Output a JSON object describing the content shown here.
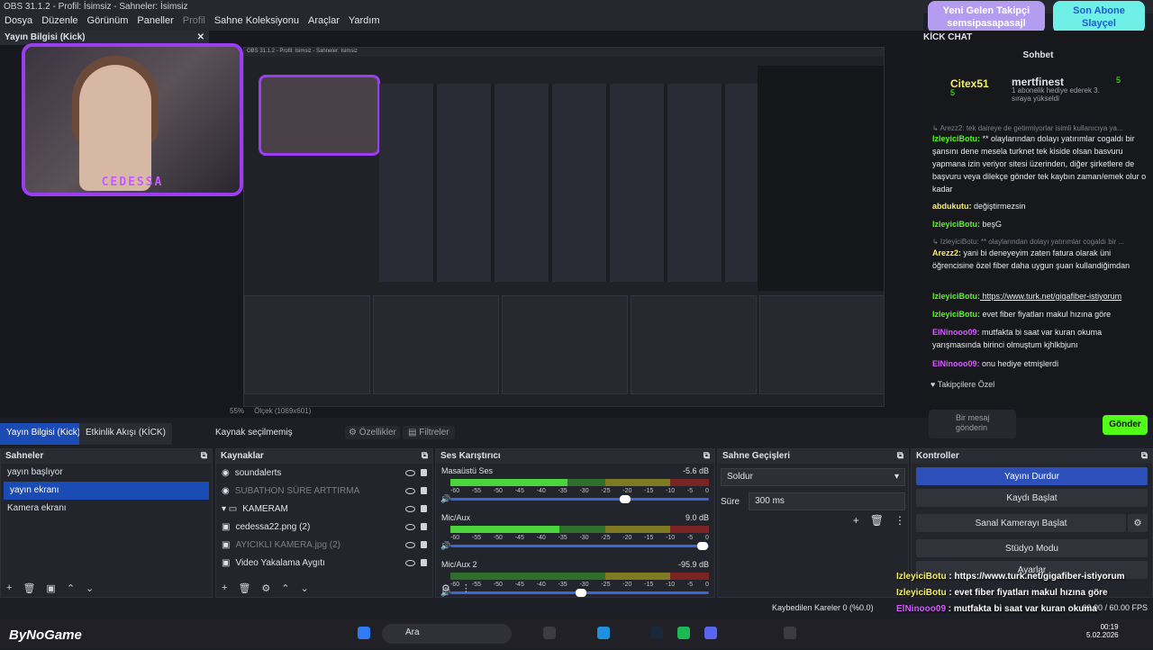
{
  "window": {
    "title": "OBS 31.1.2 - Profil: İsimsiz - Sahneler: İsimsiz"
  },
  "menu": {
    "items": [
      "Dosya",
      "Düzenle",
      "Görünüm",
      "Paneller",
      "Profil",
      "Sahne Koleksiyonu",
      "Araçlar",
      "Yardım"
    ]
  },
  "kick_dock": {
    "title": "Yayın Bilgisi (Kick)"
  },
  "webcam": {
    "label": "CEDESSA"
  },
  "preview": {
    "zoom": "55%",
    "scale_label": "Ölçek (1069x601)"
  },
  "tabs": {
    "kick": "Yayın Bilgisi (Kick)",
    "activity": "Etkinlik Akışı (KİCK)"
  },
  "source_toolbar": {
    "no_source": "Kaynak seçilmemiş",
    "properties": "Özellikler",
    "filters": "Filtreler"
  },
  "scenes": {
    "title": "Sahneler",
    "items": [
      "yayın başlıyor",
      "yayın ekranı",
      "Kamera ekranı"
    ],
    "selected_index": 1
  },
  "sources": {
    "title": "Kaynaklar",
    "items": [
      {
        "name": "soundalerts",
        "dim": false
      },
      {
        "name": "SUBATHON SÜRE ARTTIRMA",
        "dim": true
      },
      {
        "name": "KAMERAM",
        "dim": false
      },
      {
        "name": "cedessa22.png (2)",
        "dim": false
      },
      {
        "name": "AYICIKLI KAMERA.jpg (2)",
        "dim": true
      },
      {
        "name": "Video Yakalama Aygıtı",
        "dim": false
      }
    ]
  },
  "mixer": {
    "title": "Ses Karıştırıcı",
    "scale": [
      "-60",
      "-55",
      "-50",
      "-45",
      "-40",
      "-35",
      "-30",
      "-25",
      "-20",
      "-15",
      "-10",
      "-5",
      "0"
    ],
    "channels": [
      {
        "name": "Masaüstü Ses",
        "db": "-5.6 dB",
        "level": 0.45,
        "fader": 0.68
      },
      {
        "name": "Mic/Aux",
        "db": "9.0 dB",
        "level": 0.42,
        "fader": 0.99
      },
      {
        "name": "Mic/Aux 2",
        "db": "-95.9 dB",
        "level": 0.0,
        "fader": 0.5
      }
    ]
  },
  "transitions": {
    "title": "Sahne Geçişleri",
    "selected": "Soldur",
    "duration_label": "Süre",
    "duration_value": "300 ms"
  },
  "controls": {
    "title": "Kontroller",
    "buttons": [
      "Yayını Durdur",
      "Kaydı Başlat",
      "Sanal Kamerayı Başlat",
      "Stüdyo Modu",
      "Ayarlar"
    ]
  },
  "status": {
    "dropped": "Kaybedilen Kareler 0 (%0.0)",
    "fps": "60.00 / 60.00 FPS"
  },
  "chat": {
    "title": "KİCK CHAT",
    "heading": "Sohbet",
    "pinned_user": "Citex51",
    "pinned_count": "5",
    "pinned_gifter": "mertfinest",
    "pinned_gifter_count": "5",
    "pinned_text": "1 abonelik hediye ederek 3. sıraya yükseldi",
    "messages": [
      {
        "user": "",
        "text": "Arezz2: tek daireye de getirmiyorlar isimli kullanıcıya ya...",
        "cls": "reply"
      },
      {
        "user": "IzleyiciBotu:",
        "text": " ** olaylarından dolayı yatırımlar cogaldı bir şansını dene mesela turknet tek kiside olsan basvuru yapmana izin veriyor sitesi üzerinden, diğer şirketlere de başvuru veya dilekçe gönder tek kaybın zaman/emek olur o kadar",
        "cls": "user-g"
      },
      {
        "user": "abdukutu:",
        "text": " değiştirmezsin",
        "cls": "user-y"
      },
      {
        "user": "IzleyiciBotu:",
        "text": " beşG",
        "cls": "user-g"
      },
      {
        "user": "",
        "text": "IzleyiciBotu: ** olaylarından dolayı yatırımlar cogaldı bir ...",
        "cls": "reply"
      },
      {
        "user": "Arezz2:",
        "text": " yani bi deneyeyim zaten fatura olarak üni öğrencisine özel fiber daha uygun şuan kullandiğimdan",
        "cls": "user-y"
      },
      {
        "user": "IzleyiciBotu:",
        "text": " https://www.turk.net/gigafiber-istiyorum",
        "cls": "user-g",
        "link": true
      },
      {
        "user": "IzleyiciBotu:",
        "text": " evet fiber fiyatları makul hızına göre",
        "cls": "user-g"
      },
      {
        "user": "ElNinooo09:",
        "text": " mutfakta bi saat var kuran okuma yarışmasında birinci olmuştum kjhlkbjunı",
        "cls": "user-p"
      },
      {
        "user": "ElNinooo09:",
        "text": " onu hediye etmişlerdi",
        "cls": "user-p"
      }
    ],
    "follower_label": "Takipçilere Özel",
    "input_placeholder": "Bir mesaj gönderin",
    "send_label": "Gönder"
  },
  "alerts": {
    "follower": "Yeni Gelen Takipçi",
    "follower_name": "semsipasapasajl",
    "sub_line1": "Son Abone",
    "sub_line2": "Slayçel"
  },
  "overlay": {
    "lines": [
      {
        "user": "IzleyiciBotu",
        "text": " : https://www.turk.net/gigafiber-istiyorum"
      },
      {
        "user": "IzleyiciBotu",
        "text": " : evet fiber fiyatları makul hızına göre"
      },
      {
        "user": "ElNinooo09",
        "text": " : mutfakta bi saat var kuran okuma yarışmasında birinci olmuştum kjhlkbjunı"
      },
      {
        "user": "ElNinooo09",
        "text": " : onu hediye etmişlerdi"
      }
    ]
  },
  "taskbar": {
    "logo": "ByNoGame",
    "weather": "8°C",
    "search": "Ara",
    "time": "00:19",
    "date": "5.02.2026"
  }
}
